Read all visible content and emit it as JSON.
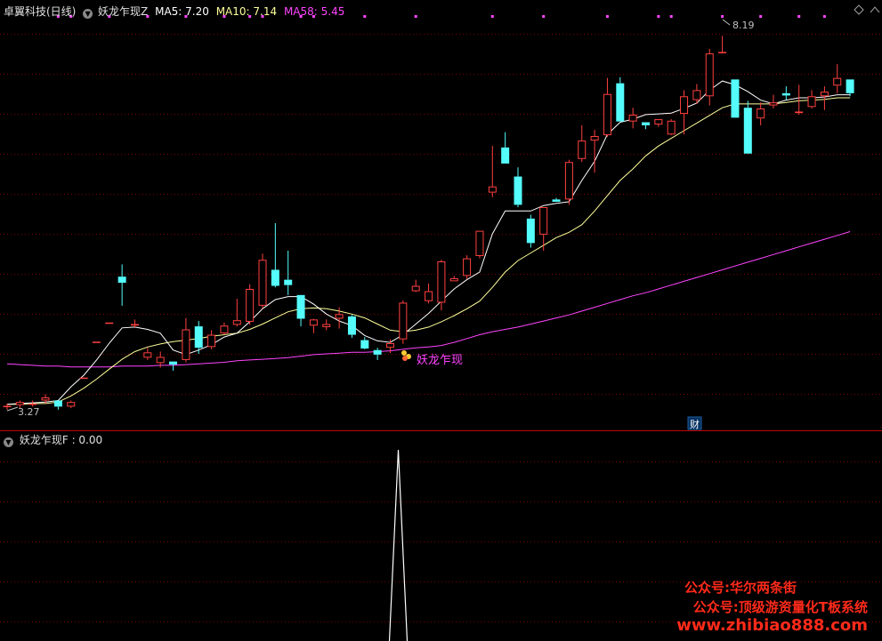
{
  "header": {
    "stock": "卓翼科技(日线)",
    "indicator": "妖龙乍现Z",
    "ma5_label": "MA5: 7.20",
    "ma10_label": "MA10: 7.14",
    "ma58_label": "MA58: 5.45"
  },
  "sub_header": {
    "indicator": "妖龙乍现F",
    "value_label": ": 0.00"
  },
  "annotations": {
    "high_label": "8.19",
    "low_label": "3.27",
    "signal_label": "妖龙乍现",
    "cai_badge": "财"
  },
  "watermark": {
    "line1": "公众号:华尔两条街",
    "line2": "公众号:顶级游资量化T板系统",
    "line3": "www.zhibiao888.com"
  },
  "colors": {
    "up": "#ff4040",
    "down": "#54fcfc",
    "ma5": "#ffffff",
    "ma10": "#ffff9a",
    "ma58": "#ff44ff",
    "grid": "#7a0000",
    "text": "#c0c0c0"
  },
  "chart_data": [
    {
      "type": "candlestick",
      "ylim": [
        3.1,
        8.45
      ],
      "highest": 8.19,
      "lowest": 3.27,
      "signal_index": 30,
      "ohlc": [
        [
          3.35,
          3.38,
          3.3,
          3.35
        ],
        [
          3.36,
          3.42,
          3.32,
          3.4
        ],
        [
          3.38,
          3.42,
          3.34,
          3.38
        ],
        [
          3.42,
          3.5,
          3.38,
          3.46
        ],
        [
          3.42,
          3.42,
          3.3,
          3.34
        ],
        [
          3.34,
          3.42,
          3.32,
          3.4
        ],
        [
          3.72,
          3.72,
          3.72,
          3.72
        ],
        [
          4.19,
          4.19,
          4.19,
          4.19
        ],
        [
          4.44,
          4.44,
          4.44,
          4.44
        ],
        [
          5.04,
          5.2,
          4.66,
          4.96
        ],
        [
          4.4,
          4.48,
          4.38,
          4.42
        ],
        [
          3.98,
          4.11,
          3.95,
          4.05
        ],
        [
          3.91,
          4.06,
          3.85,
          3.99
        ],
        [
          3.93,
          3.93,
          3.81,
          3.89
        ],
        [
          3.95,
          4.5,
          3.92,
          4.35
        ],
        [
          4.39,
          4.46,
          4.03,
          4.11
        ],
        [
          4.12,
          4.34,
          4.09,
          4.28
        ],
        [
          4.3,
          4.44,
          4.28,
          4.4
        ],
        [
          4.41,
          4.75,
          4.39,
          4.47
        ],
        [
          4.45,
          4.94,
          4.41,
          4.88
        ],
        [
          4.66,
          5.34,
          4.62,
          5.26
        ],
        [
          5.13,
          5.74,
          4.9,
          4.92
        ],
        [
          5.0,
          5.38,
          4.8,
          4.93
        ],
        [
          4.8,
          4.8,
          4.39,
          4.49
        ],
        [
          4.4,
          4.49,
          4.3,
          4.48
        ],
        [
          4.38,
          4.48,
          4.34,
          4.42
        ],
        [
          4.49,
          4.64,
          4.36,
          4.55
        ],
        [
          4.52,
          4.54,
          4.24,
          4.28
        ],
        [
          4.21,
          4.25,
          4.09,
          4.1
        ],
        [
          4.08,
          4.11,
          3.95,
          4.02
        ],
        [
          4.11,
          4.22,
          4.04,
          4.17
        ],
        [
          4.22,
          4.73,
          4.16,
          4.7
        ],
        [
          4.85,
          5.0,
          4.84,
          4.92
        ],
        [
          4.72,
          4.95,
          4.69,
          4.85
        ],
        [
          4.7,
          5.26,
          4.6,
          5.24
        ],
        [
          4.98,
          5.05,
          4.98,
          5.02
        ],
        [
          5.05,
          5.32,
          5.01,
          5.28
        ],
        [
          5.31,
          5.64,
          5.28,
          5.64
        ],
        [
          6.14,
          6.75,
          6.08,
          6.22
        ],
        [
          6.73,
          6.93,
          6.52,
          6.52
        ],
        [
          6.35,
          6.47,
          5.95,
          5.98
        ],
        [
          5.8,
          5.85,
          5.42,
          5.48
        ],
        [
          5.59,
          5.95,
          5.38,
          5.95
        ],
        [
          6.05,
          6.07,
          6.02,
          6.02
        ],
        [
          6.05,
          6.57,
          5.98,
          6.54
        ],
        [
          6.58,
          7.02,
          6.54,
          6.82
        ],
        [
          6.82,
          6.96,
          6.4,
          6.88
        ],
        [
          6.89,
          7.64,
          6.87,
          7.43
        ],
        [
          7.57,
          7.65,
          7.07,
          7.07
        ],
        [
          7.07,
          7.25,
          6.98,
          7.16
        ],
        [
          7.06,
          7.06,
          6.97,
          7.02
        ],
        [
          7.03,
          7.1,
          7.0,
          7.1
        ],
        [
          6.9,
          7.1,
          6.89,
          7.08
        ],
        [
          7.17,
          7.48,
          6.9,
          7.4
        ],
        [
          7.35,
          7.56,
          7.3,
          7.48
        ],
        [
          7.4,
          8.02,
          7.28,
          7.96
        ],
        [
          7.98,
          8.19,
          7.96,
          7.98
        ],
        [
          7.62,
          7.62,
          7.12,
          7.12
        ],
        [
          7.25,
          7.34,
          6.65,
          6.65
        ],
        [
          7.11,
          7.32,
          7.02,
          7.24
        ],
        [
          7.28,
          7.42,
          7.24,
          7.32
        ],
        [
          7.44,
          7.53,
          7.35,
          7.41
        ],
        [
          7.18,
          7.55,
          7.16,
          7.2
        ],
        [
          7.26,
          7.48,
          7.24,
          7.4
        ],
        [
          7.4,
          7.53,
          7.22,
          7.46
        ],
        [
          7.54,
          7.82,
          7.44,
          7.64
        ],
        [
          7.62,
          7.62,
          7.4,
          7.44
        ]
      ],
      "ma5": [
        3.37,
        3.38,
        3.39,
        3.4,
        3.42,
        3.6,
        3.75,
        3.95,
        4.17,
        4.37,
        4.38,
        4.35,
        4.3,
        4.08,
        4.02,
        4.08,
        4.15,
        4.25,
        4.3,
        4.45,
        4.62,
        4.74,
        4.78,
        4.78,
        4.68,
        4.55,
        4.46,
        4.4,
        4.27,
        4.2,
        4.18,
        4.28,
        4.42,
        4.56,
        4.72,
        4.88,
        5.0,
        5.1,
        5.6,
        5.9,
        5.9,
        5.9,
        5.97,
        6.0,
        6.02,
        6.3,
        6.55,
        6.9,
        7.06,
        7.1,
        7.16,
        7.17,
        7.18,
        7.24,
        7.31,
        7.48,
        7.6,
        7.55,
        7.46,
        7.35,
        7.3,
        7.35,
        7.38,
        7.38,
        7.39,
        7.42,
        7.42
      ],
      "ma10": [
        3.37,
        3.37,
        3.38,
        3.38,
        3.4,
        3.48,
        3.58,
        3.7,
        3.83,
        3.96,
        4.06,
        4.12,
        4.16,
        4.19,
        4.21,
        4.23,
        4.26,
        4.28,
        4.3,
        4.35,
        4.42,
        4.5,
        4.58,
        4.62,
        4.63,
        4.62,
        4.59,
        4.55,
        4.5,
        4.42,
        4.34,
        4.32,
        4.34,
        4.38,
        4.45,
        4.53,
        4.62,
        4.72,
        4.9,
        5.1,
        5.25,
        5.35,
        5.45,
        5.55,
        5.62,
        5.72,
        5.9,
        6.1,
        6.3,
        6.45,
        6.62,
        6.75,
        6.85,
        6.95,
        7.05,
        7.15,
        7.25,
        7.3,
        7.3,
        7.3,
        7.3,
        7.32,
        7.34,
        7.35,
        7.36,
        7.38,
        7.38
      ],
      "ma58": [
        3.9,
        3.89,
        3.88,
        3.87,
        3.87,
        3.86,
        3.86,
        3.86,
        3.86,
        3.87,
        3.87,
        3.87,
        3.88,
        3.88,
        3.89,
        3.9,
        3.91,
        3.92,
        3.94,
        3.95,
        3.96,
        3.97,
        3.98,
        4.0,
        4.02,
        4.03,
        4.04,
        4.05,
        4.05,
        4.06,
        4.07,
        4.09,
        4.11,
        4.12,
        4.14,
        4.18,
        4.23,
        4.28,
        4.32,
        4.35,
        4.38,
        4.42,
        4.46,
        4.5,
        4.54,
        4.59,
        4.64,
        4.69,
        4.74,
        4.79,
        4.83,
        4.88,
        4.93,
        4.98,
        5.03,
        5.08,
        5.13,
        5.18,
        5.23,
        5.28,
        5.33,
        5.38,
        5.43,
        5.48,
        5.53,
        5.58,
        5.63
      ],
      "top_dot_indices": [
        4,
        5,
        8,
        11,
        14,
        17,
        19,
        20,
        23,
        24,
        28,
        32,
        38,
        42,
        47,
        51,
        52,
        56,
        59,
        62,
        64
      ]
    },
    {
      "type": "line",
      "series": [
        {
          "values_at_signal": 1
        }
      ],
      "value": 0.0,
      "signal_index": 30
    }
  ]
}
